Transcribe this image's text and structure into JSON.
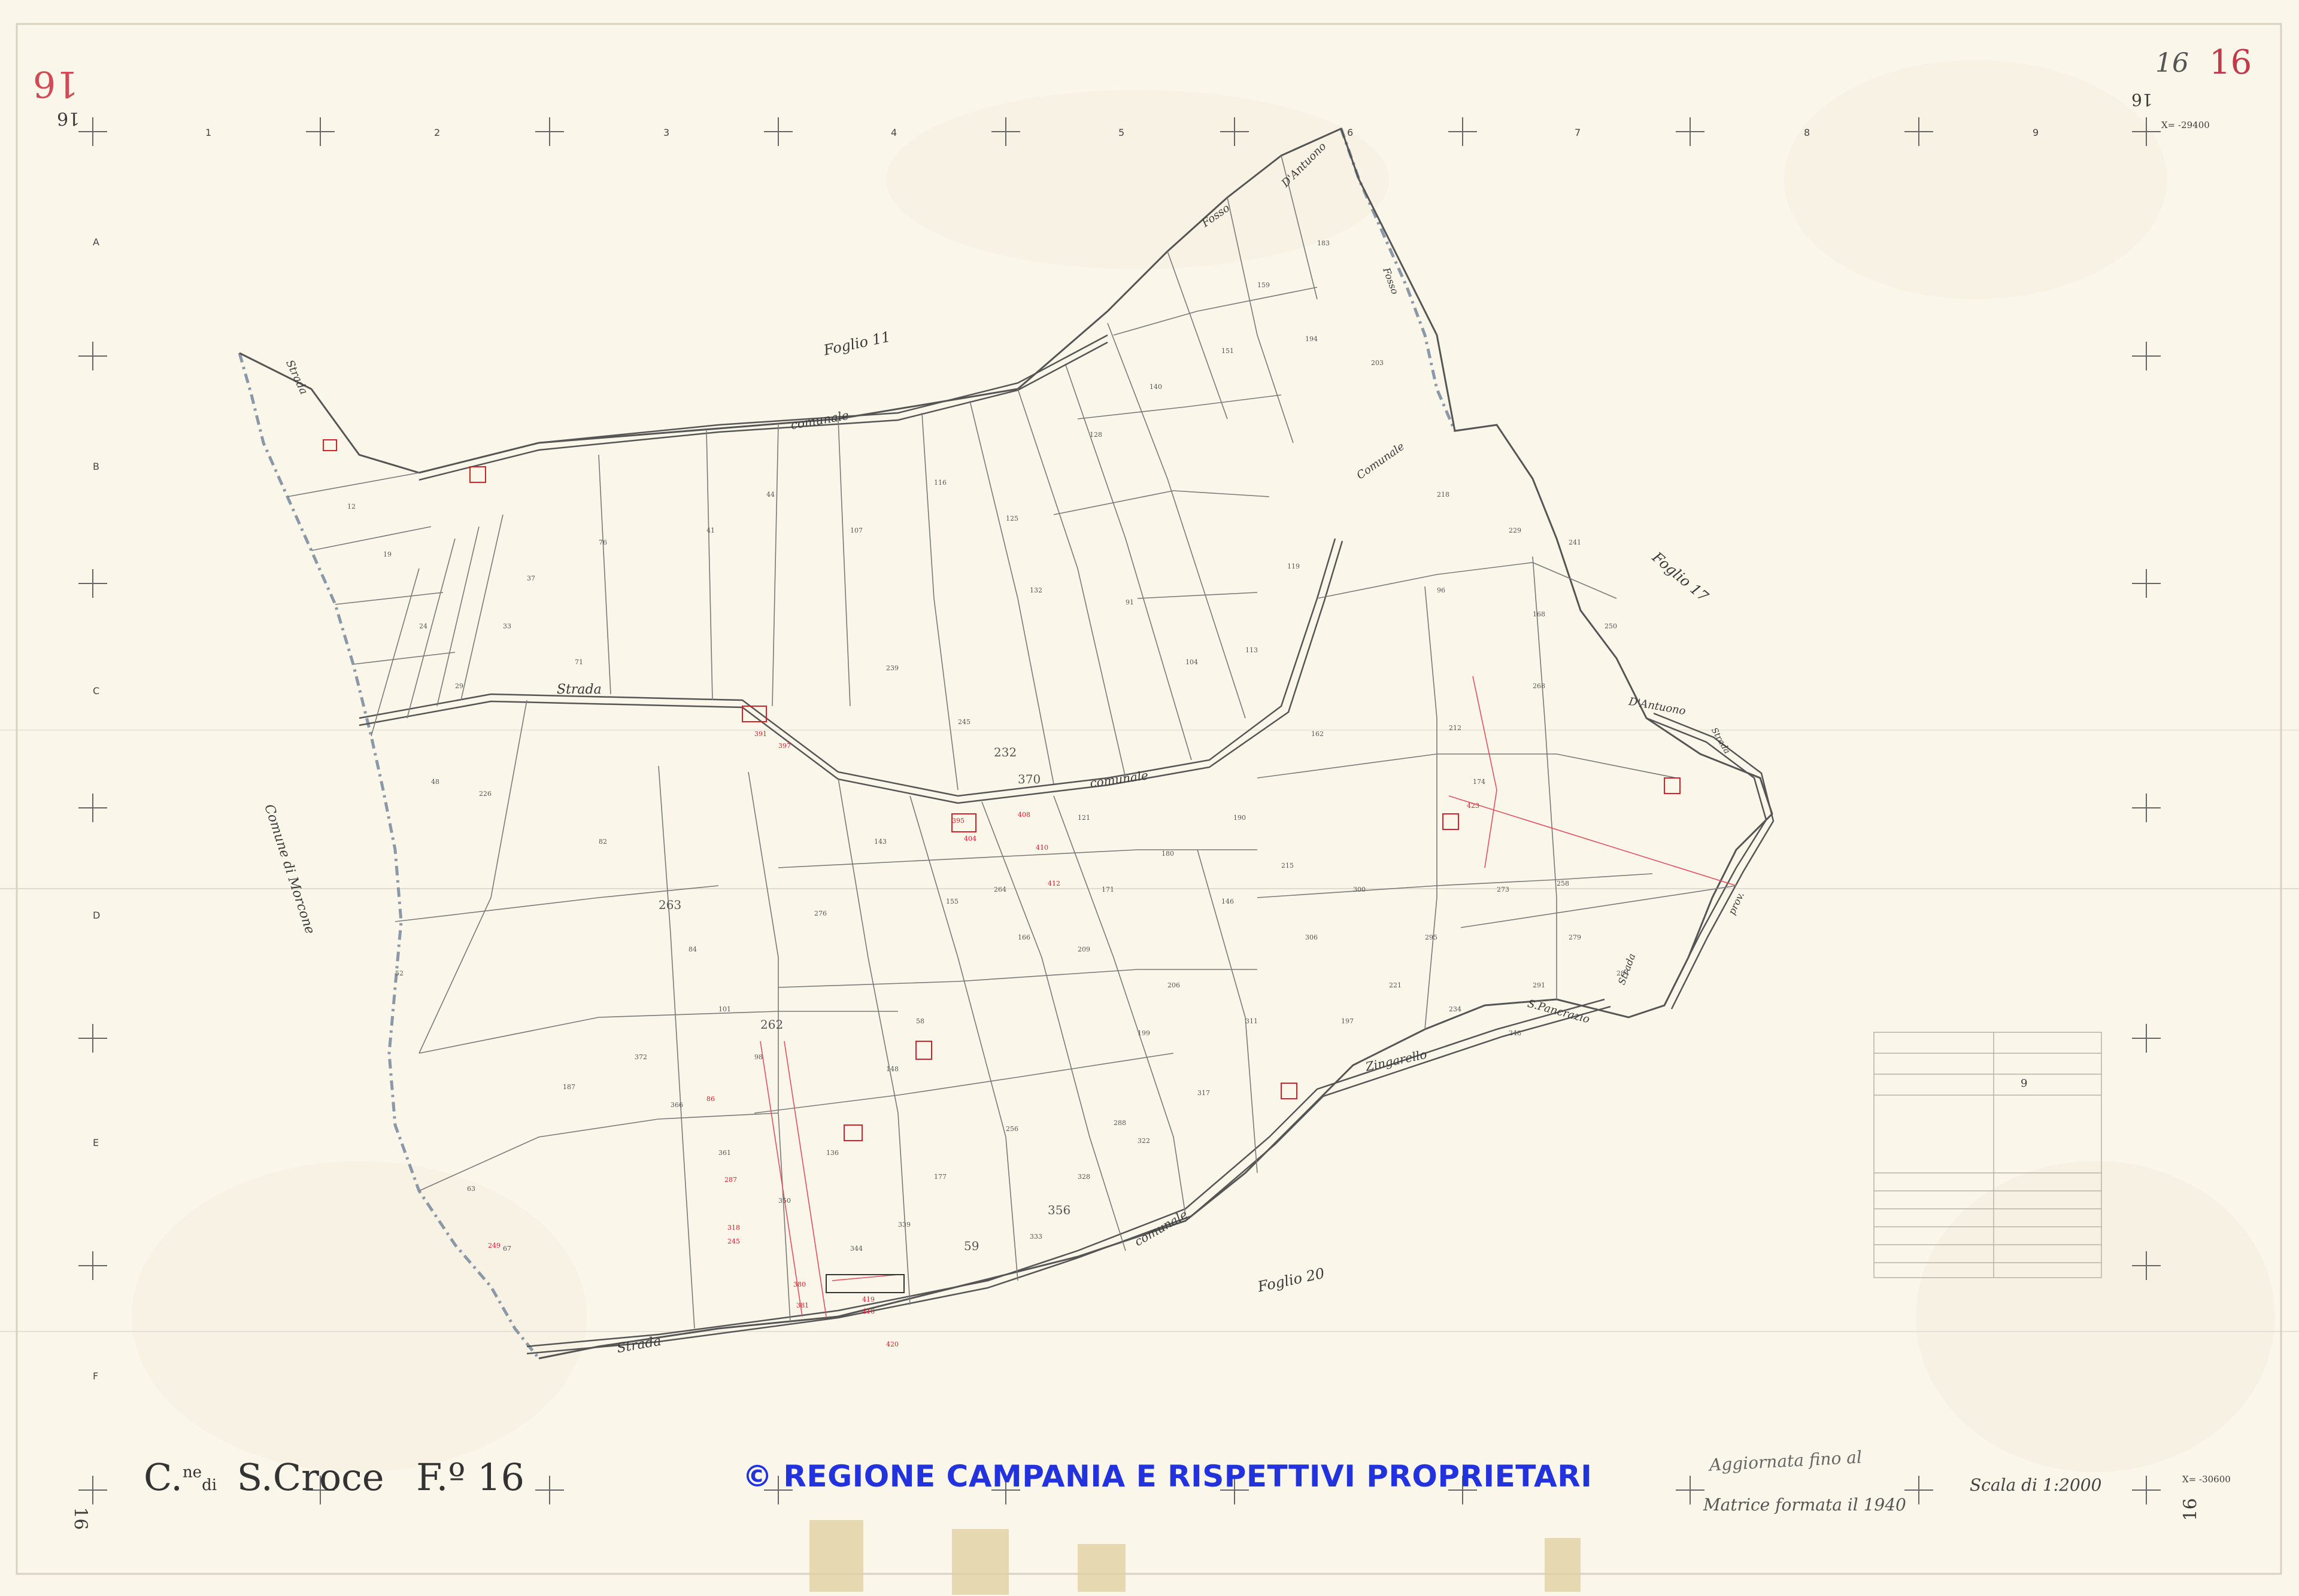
{
  "sheet": {
    "corner_numbers": {
      "top_left": "16",
      "top_right": "16",
      "top_right_small": "16",
      "bottom_left": "16",
      "bottom_right": "16"
    },
    "corner_codes": {
      "top_right": "X= -29400",
      "bottom_right": "X= -30600"
    },
    "title": {
      "prefix": "C.",
      "prefix_sup": "ne",
      "prefix_sub": "di",
      "comune": "S.Croce",
      "foglio": "F.º 16"
    },
    "copyright": "© REGIONE CAMPANIA E RISPETTIVI PROPRIETARI",
    "notes": {
      "line1": "Aggiornata fino al",
      "line2": "Matrice formata il 1940"
    },
    "scale": "Scala di 1:2000"
  },
  "grid": {
    "columns": [
      "1",
      "2",
      "3",
      "4",
      "5",
      "6",
      "7",
      "8",
      "9"
    ],
    "rows": [
      "A",
      "B",
      "C",
      "D",
      "E",
      "F"
    ]
  },
  "map_labels": {
    "foglio_north": "Foglio 11",
    "foglio_east": "Foglio 17",
    "foglio_south": "Foglio 20",
    "comune_west": "Comune di Morcone",
    "road_comunale_north": "comunale",
    "road_strada_mid": "Strada",
    "road_comunale_mid": "comunale",
    "road_strada_nw": "Strada",
    "road_strada_south": "Strada",
    "road_comunale_south": "comunale",
    "fosso_n1": "Fosso",
    "fosso_n2": "D'Antuono",
    "fosso_e": "Fosso",
    "road_comunale_ne": "Comunale",
    "dantuono_e": "D'Antuono",
    "strada_prov": "Strada",
    "prov": "prov.",
    "zingarello": "Zingarello",
    "s_pancrazio": "S.Pancrazio",
    "strada_se": "Strada"
  },
  "parcels": [
    {
      "t": "263"
    },
    {
      "t": "262"
    },
    {
      "t": "232"
    },
    {
      "t": "370"
    },
    {
      "t": "356"
    },
    {
      "t": "59"
    },
    {
      "t": "58"
    },
    {
      "t": "148"
    },
    {
      "t": "212"
    },
    {
      "t": "98"
    },
    {
      "t": "121"
    },
    {
      "t": "146"
    },
    {
      "t": "162"
    },
    {
      "t": "206"
    },
    {
      "t": "209"
    },
    {
      "t": "199"
    },
    {
      "t": "187"
    },
    {
      "t": "96"
    },
    {
      "t": "168"
    },
    {
      "t": "174"
    },
    {
      "t": "226"
    },
    {
      "t": "239"
    },
    {
      "t": "245"
    },
    {
      "t": "264"
    },
    {
      "t": "101"
    },
    {
      "t": "136"
    },
    {
      "t": "177"
    },
    {
      "t": "256"
    },
    {
      "t": "288"
    },
    {
      "t": "215"
    },
    {
      "t": "82"
    },
    {
      "t": "84"
    },
    {
      "t": "91"
    },
    {
      "t": "104"
    },
    {
      "t": "113"
    },
    {
      "t": "119"
    },
    {
      "t": "128"
    },
    {
      "t": "140"
    },
    {
      "t": "151"
    },
    {
      "t": "159"
    },
    {
      "t": "183"
    },
    {
      "t": "194"
    },
    {
      "t": "203"
    },
    {
      "t": "218"
    },
    {
      "t": "229"
    },
    {
      "t": "241"
    },
    {
      "t": "250"
    },
    {
      "t": "268"
    },
    {
      "t": "273"
    },
    {
      "t": "279"
    },
    {
      "t": "284"
    },
    {
      "t": "291"
    },
    {
      "t": "295"
    },
    {
      "t": "300"
    },
    {
      "t": "306"
    },
    {
      "t": "311"
    },
    {
      "t": "317"
    },
    {
      "t": "322"
    },
    {
      "t": "328"
    },
    {
      "t": "333"
    },
    {
      "t": "339"
    },
    {
      "t": "344"
    },
    {
      "t": "350"
    },
    {
      "t": "361"
    },
    {
      "t": "366"
    },
    {
      "t": "372"
    },
    {
      "t": "48"
    },
    {
      "t": "52"
    },
    {
      "t": "63"
    },
    {
      "t": "67"
    },
    {
      "t": "71"
    },
    {
      "t": "76"
    },
    {
      "t": "12"
    },
    {
      "t": "19"
    },
    {
      "t": "24"
    },
    {
      "t": "29"
    },
    {
      "t": "33"
    },
    {
      "t": "37"
    },
    {
      "t": "41"
    },
    {
      "t": "44"
    },
    {
      "t": "107"
    },
    {
      "t": "116"
    },
    {
      "t": "125"
    },
    {
      "t": "132"
    },
    {
      "t": "143"
    },
    {
      "t": "155"
    },
    {
      "t": "166"
    },
    {
      "t": "171"
    },
    {
      "t": "180"
    },
    {
      "t": "190"
    },
    {
      "t": "197"
    },
    {
      "t": "221"
    },
    {
      "t": "234"
    },
    {
      "t": "248"
    },
    {
      "t": "258"
    },
    {
      "t": "276"
    }
  ],
  "red_parcels": [
    {
      "t": "318"
    },
    {
      "t": "245"
    },
    {
      "t": "249"
    },
    {
      "t": "86"
    },
    {
      "t": "287"
    },
    {
      "t": "380"
    },
    {
      "t": "381"
    },
    {
      "t": "419"
    },
    {
      "t": "416"
    },
    {
      "t": "420"
    },
    {
      "t": "395"
    },
    {
      "t": "404"
    },
    {
      "t": "408"
    },
    {
      "t": "410"
    },
    {
      "t": "412"
    },
    {
      "t": "391"
    },
    {
      "t": "397"
    },
    {
      "t": "423"
    }
  ],
  "legend_table": {
    "cell": "9"
  },
  "colors": {
    "paper": "#faf6ea",
    "ink": "#444444",
    "red": "#d8202a",
    "blue": "#2233dd",
    "boundary": "#8a98a8"
  }
}
